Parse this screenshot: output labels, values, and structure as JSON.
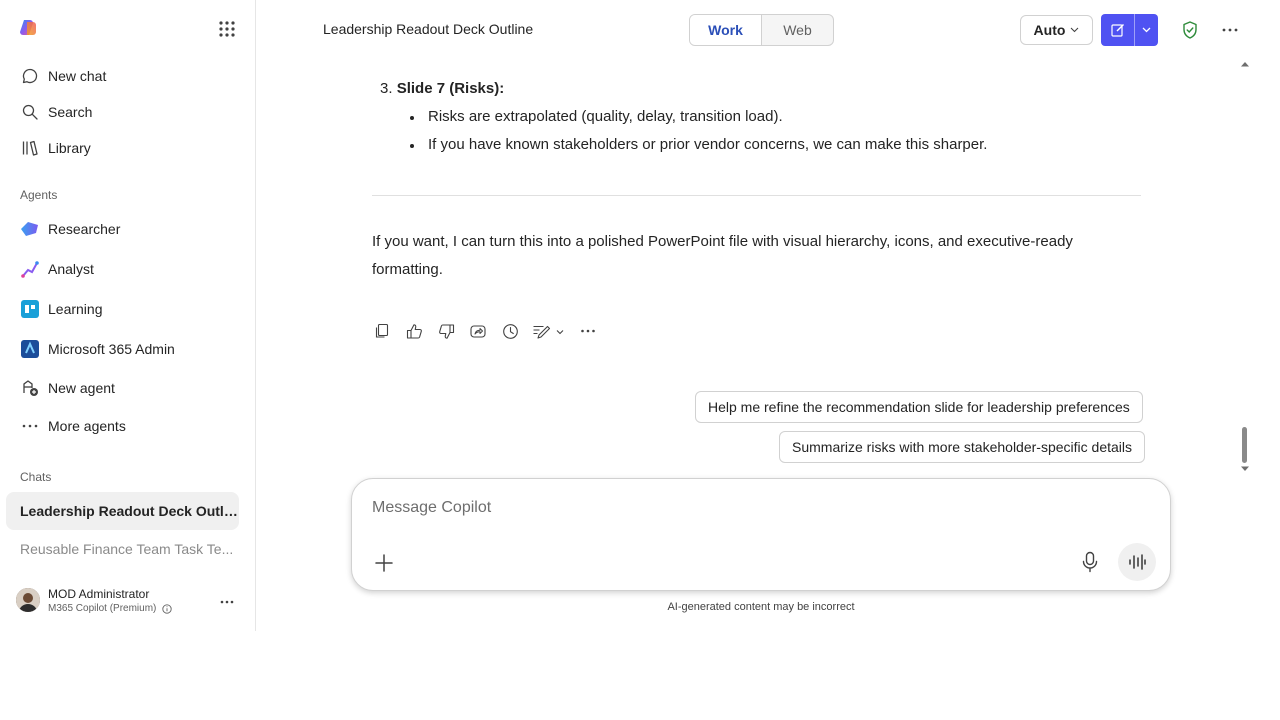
{
  "sidebar": {
    "nav": [
      {
        "label": "New chat",
        "icon": "chat-bubble-icon"
      },
      {
        "label": "Search",
        "icon": "search-icon"
      },
      {
        "label": "Library",
        "icon": "library-icon"
      }
    ],
    "agents_heading": "Agents",
    "agents": [
      {
        "label": "Researcher",
        "icon": "researcher-icon"
      },
      {
        "label": "Analyst",
        "icon": "analyst-icon"
      },
      {
        "label": "Learning",
        "icon": "learning-icon"
      },
      {
        "label": "Microsoft 365 Admin",
        "icon": "m365-admin-icon"
      },
      {
        "label": "New agent",
        "icon": "new-agent-icon"
      },
      {
        "label": "More agents",
        "icon": "more-agents-icon"
      }
    ],
    "chats_heading": "Chats",
    "chats": [
      {
        "label": "Leadership Readout Deck Outline",
        "active": true
      },
      {
        "label": "Reusable Finance Team Task Te...",
        "active": false
      }
    ],
    "profile": {
      "name": "MOD Administrator",
      "plan": "M365 Copilot (Premium)"
    }
  },
  "header": {
    "title": "Leadership Readout Deck Outline",
    "toggle": {
      "work": "Work",
      "web": "Web",
      "selected": "Work"
    },
    "model_label": "Auto"
  },
  "content": {
    "list_item": {
      "number": "3.",
      "title": "Slide 7 (Risks):"
    },
    "bullets": [
      "Risks are extrapolated (quality, delay, transition load).",
      "If you have known stakeholders or prior vendor concerns, we can make this sharper."
    ],
    "closing": "If you want, I can turn this into a polished PowerPoint file with visual hierarchy, icons, and executive-ready formatting.",
    "suggestions": [
      "Help me refine the recommendation slide for leadership preferences",
      "Summarize risks with more stakeholder-specific details"
    ]
  },
  "composer": {
    "placeholder": "Message Copilot",
    "disclaimer": "AI-generated content may be incorrect"
  },
  "colors": {
    "accent": "#4f52f2",
    "toggle_active": "#2b4fb8",
    "shield": "#2e8b3a"
  }
}
